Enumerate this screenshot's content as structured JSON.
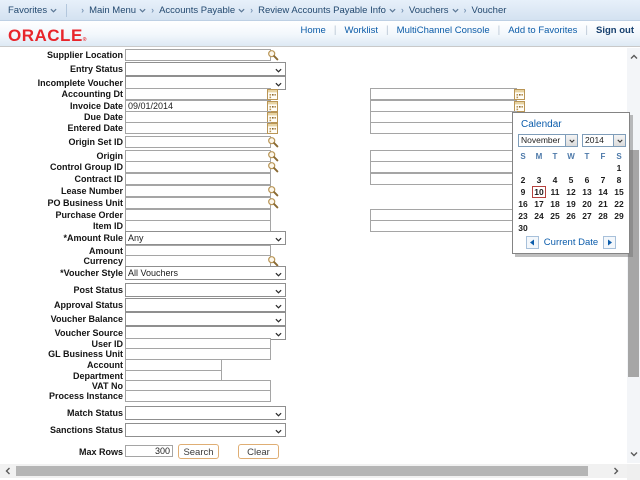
{
  "colors": {
    "link_blue": "#0b5ca8",
    "oracle_red": "#e8252b",
    "crumb_bg": "#d9e5f2",
    "button_border": "#dfae74",
    "selected_day_border": "#b5413d"
  },
  "breadcrumb": {
    "favorites": "Favorites",
    "items": [
      {
        "label": "Main Menu",
        "menu": true
      },
      {
        "label": "Accounts Payable",
        "menu": true
      },
      {
        "label": "Review Accounts Payable Info",
        "menu": true
      },
      {
        "label": "Vouchers",
        "menu": true
      },
      {
        "label": "Voucher",
        "menu": false
      }
    ]
  },
  "header": {
    "logo": "ORACLE",
    "links": [
      "Home",
      "Worklist",
      "MultiChannel Console",
      "Add to Favorites"
    ],
    "signout": "Sign out"
  },
  "form": {
    "rows": [
      {
        "label": "Supplier Location",
        "type": "lookup",
        "value": ""
      },
      {
        "label": "Entry Status",
        "type": "select",
        "value": ""
      },
      {
        "label": "Incomplete Voucher",
        "type": "select",
        "value": ""
      },
      {
        "label": "Accounting Dt",
        "type": "date",
        "value": ""
      },
      {
        "label": "Invoice Date",
        "type": "date",
        "value": "09/01/2014"
      },
      {
        "label": "Due Date",
        "type": "date",
        "value": ""
      },
      {
        "label": "Entered Date",
        "type": "date",
        "value": ""
      },
      {
        "label": "Origin Set ID",
        "type": "lookup",
        "value": ""
      },
      {
        "label": "Origin",
        "type": "lookup",
        "value": ""
      },
      {
        "label": "Control Group ID",
        "type": "lookup",
        "value": ""
      },
      {
        "label": "Contract ID",
        "type": "text",
        "value": ""
      },
      {
        "label": "Lease Number",
        "type": "lookup",
        "value": ""
      },
      {
        "label": "PO Business Unit",
        "type": "lookup",
        "value": ""
      },
      {
        "label": "Purchase Order",
        "type": "text",
        "value": ""
      },
      {
        "label": "Item ID",
        "type": "text",
        "value": ""
      },
      {
        "label": "*Amount Rule",
        "type": "select",
        "value": "Any"
      },
      {
        "label": "Amount",
        "type": "text",
        "value": ""
      },
      {
        "label": "Currency",
        "type": "lookup",
        "value": ""
      },
      {
        "label": "*Voucher Style",
        "type": "select",
        "value": "All Vouchers"
      },
      {
        "label": "Post Status",
        "type": "select",
        "value": ""
      },
      {
        "label": "Approval Status",
        "type": "select",
        "value": ""
      },
      {
        "label": "Voucher Balance",
        "type": "select",
        "value": ""
      },
      {
        "label": "Voucher Source",
        "type": "select",
        "value": ""
      },
      {
        "label": "User ID",
        "type": "text",
        "value": ""
      },
      {
        "label": "GL Business Unit",
        "type": "text",
        "value": ""
      },
      {
        "label": "Account",
        "type": "text",
        "value": ""
      },
      {
        "label": "Department",
        "type": "text",
        "value": ""
      },
      {
        "label": "VAT No",
        "type": "text",
        "value": ""
      },
      {
        "label": "Process Instance",
        "type": "text",
        "value": ""
      },
      {
        "label": "Match Status",
        "type": "select",
        "value": ""
      },
      {
        "label": "Sanctions Status",
        "type": "select",
        "value": ""
      }
    ],
    "max_rows": {
      "label": "Max Rows",
      "value": "300"
    },
    "buttons": {
      "search": "Search",
      "clear": "Clear"
    }
  },
  "calendar": {
    "title": "Calendar",
    "month": "November",
    "year": "2014",
    "weekdays": [
      "S",
      "M",
      "T",
      "W",
      "T",
      "F",
      "S"
    ],
    "weeks": [
      [
        "",
        "",
        "",
        "",
        "",
        "",
        "1"
      ],
      [
        "2",
        "3",
        "4",
        "5",
        "6",
        "7",
        "8"
      ],
      [
        "9",
        "10",
        "11",
        "12",
        "13",
        "14",
        "15"
      ],
      [
        "16",
        "17",
        "18",
        "19",
        "20",
        "21",
        "22"
      ],
      [
        "23",
        "24",
        "25",
        "26",
        "27",
        "28",
        "29"
      ],
      [
        "30",
        "",
        "",
        "",
        "",
        "",
        ""
      ]
    ],
    "selected_day": "10",
    "footer": "Current Date"
  }
}
